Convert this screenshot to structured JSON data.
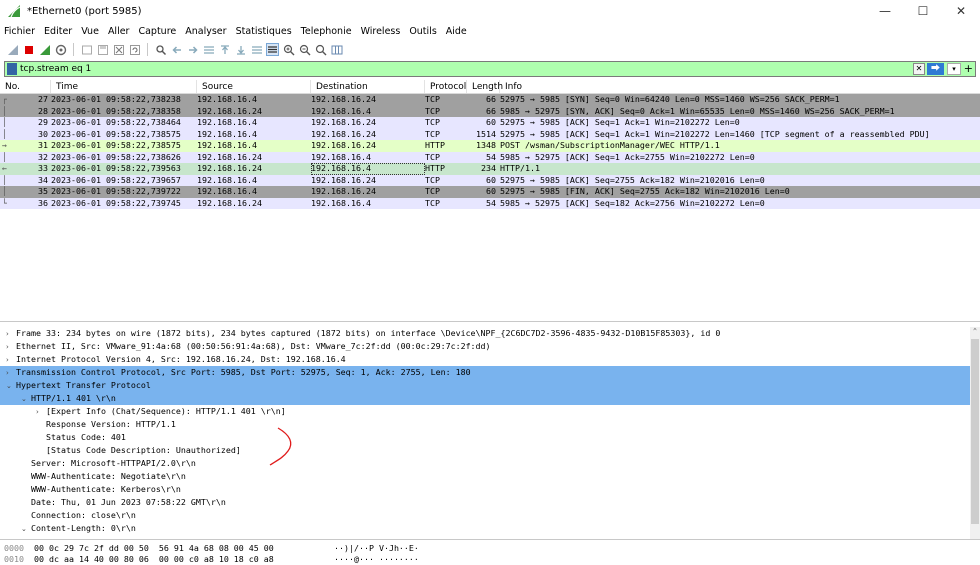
{
  "window": {
    "title": "*Ethernet0 (port 5985)",
    "minimize": "—",
    "maximize": "☐",
    "close": "✕"
  },
  "menu": [
    "Fichier",
    "Editer",
    "Vue",
    "Aller",
    "Capture",
    "Analyser",
    "Statistiques",
    "Telephonie",
    "Wireless",
    "Outils",
    "Aide"
  ],
  "filter": {
    "value": "tcp.stream eq 1"
  },
  "packet_list": {
    "headers": {
      "no": "No.",
      "time": "Time",
      "source": "Source",
      "destination": "Destination",
      "protocol": "Protocol",
      "length": "Length",
      "info": "Info"
    },
    "rows": [
      {
        "no": "27",
        "time": "2023-06-01 09:58:22,738238",
        "src": "192.168.16.4",
        "dst": "192.168.16.24",
        "proto": "TCP",
        "len": "66",
        "info": "52975 → 5985 [SYN] Seq=0 Win=64240 Len=0 MSS=1460 WS=256 SACK_PERM=1",
        "ind": "┌",
        "color": "syn"
      },
      {
        "no": "28",
        "time": "2023-06-01 09:58:22,738358",
        "src": "192.168.16.24",
        "dst": "192.168.16.4",
        "proto": "TCP",
        "len": "66",
        "info": "5985 → 52975 [SYN, ACK] Seq=0 Ack=1 Win=65535 Len=0 MSS=1460 WS=256 SACK_PERM=1",
        "ind": "│",
        "color": "syn"
      },
      {
        "no": "29",
        "time": "2023-06-01 09:58:22,738464",
        "src": "192.168.16.4",
        "dst": "192.168.16.24",
        "proto": "TCP",
        "len": "60",
        "info": "52975 → 5985 [ACK] Seq=1 Ack=1 Win=2102272 Len=0",
        "ind": "│",
        "color": "tcp"
      },
      {
        "no": "30",
        "time": "2023-06-01 09:58:22,738575",
        "src": "192.168.16.4",
        "dst": "192.168.16.24",
        "proto": "TCP",
        "len": "1514",
        "info": "52975 → 5985 [ACK] Seq=1 Ack=1 Win=2102272 Len=1460 [TCP segment of a reassembled PDU]",
        "ind": "│",
        "color": "tcp"
      },
      {
        "no": "31",
        "time": "2023-06-01 09:58:22,738575",
        "src": "192.168.16.4",
        "dst": "192.168.16.24",
        "proto": "HTTP",
        "len": "1348",
        "info": "POST /wsman/SubscriptionManager/WEC HTTP/1.1",
        "ind": "→",
        "color": "http"
      },
      {
        "no": "32",
        "time": "2023-06-01 09:58:22,738626",
        "src": "192.168.16.24",
        "dst": "192.168.16.4",
        "proto": "TCP",
        "len": "54",
        "info": "5985 → 52975 [ACK] Seq=1 Ack=2755 Win=2102272 Len=0",
        "ind": "│",
        "color": "tcp"
      },
      {
        "no": "33",
        "time": "2023-06-01 09:58:22,739563",
        "src": "192.168.16.24",
        "dst": "192.168.16.4",
        "proto": "HTTP",
        "len": "234",
        "info": "HTTP/1.1 401",
        "ind": "←",
        "color": "sel"
      },
      {
        "no": "34",
        "time": "2023-06-01 09:58:22,739657",
        "src": "192.168.16.4",
        "dst": "192.168.16.24",
        "proto": "TCP",
        "len": "60",
        "info": "52975 → 5985 [ACK] Seq=2755 Ack=182 Win=2102016 Len=0",
        "ind": "│",
        "color": "tcp"
      },
      {
        "no": "35",
        "time": "2023-06-01 09:58:22,739722",
        "src": "192.168.16.4",
        "dst": "192.168.16.24",
        "proto": "TCP",
        "len": "60",
        "info": "52975 → 5985 [FIN, ACK] Seq=2755 Ack=182 Win=2102016 Len=0",
        "ind": "│",
        "color": "syn"
      },
      {
        "no": "36",
        "time": "2023-06-01 09:58:22,739745",
        "src": "192.168.16.24",
        "dst": "192.168.16.4",
        "proto": "TCP",
        "len": "54",
        "info": "5985 → 52975 [ACK] Seq=182 Ack=2756 Win=2102272 Len=0",
        "ind": "└",
        "color": "tcp"
      }
    ]
  },
  "details": [
    {
      "text": "Frame 33: 234 bytes on wire (1872 bits), 234 bytes captured (1872 bits) on interface \\Device\\NPF_{2C6DC7D2-3596-4835-9432-D10B15F85303}, id 0",
      "indent": 0,
      "arrow": "›",
      "sel": false
    },
    {
      "text": "Ethernet II, Src: VMware_91:4a:68 (00:50:56:91:4a:68), Dst: VMware_7c:2f:dd (00:0c:29:7c:2f:dd)",
      "indent": 0,
      "arrow": "›",
      "sel": false
    },
    {
      "text": "Internet Protocol Version 4, Src: 192.168.16.24, Dst: 192.168.16.4",
      "indent": 0,
      "arrow": "›",
      "sel": false
    },
    {
      "text": "Transmission Control Protocol, Src Port: 5985, Dst Port: 52975, Seq: 1, Ack: 2755, Len: 180",
      "indent": 0,
      "arrow": "›",
      "sel": true
    },
    {
      "text": "Hypertext Transfer Protocol",
      "indent": 0,
      "arrow": "⌄",
      "sel": true
    },
    {
      "text": "HTTP/1.1 401 \\r\\n",
      "indent": 1,
      "arrow": "⌄",
      "sel": true
    },
    {
      "text": "[Expert Info (Chat/Sequence): HTTP/1.1 401 \\r\\n]",
      "indent": 2,
      "arrow": "›",
      "sel": false
    },
    {
      "text": "Response Version: HTTP/1.1",
      "indent": 2,
      "arrow": "",
      "sel": false
    },
    {
      "text": "Status Code: 401",
      "indent": 2,
      "arrow": "",
      "sel": false
    },
    {
      "text": "[Status Code Description: Unauthorized]",
      "indent": 2,
      "arrow": "",
      "sel": false
    },
    {
      "text": "Server: Microsoft-HTTPAPI/2.0\\r\\n",
      "indent": 1,
      "arrow": "",
      "sel": false
    },
    {
      "text": "WWW-Authenticate: Negotiate\\r\\n",
      "indent": 1,
      "arrow": "",
      "sel": false
    },
    {
      "text": "WWW-Authenticate: Kerberos\\r\\n",
      "indent": 1,
      "arrow": "",
      "sel": false
    },
    {
      "text": "Date: Thu, 01 Jun 2023 07:58:22 GMT\\r\\n",
      "indent": 1,
      "arrow": "",
      "sel": false
    },
    {
      "text": "Connection: close\\r\\n",
      "indent": 1,
      "arrow": "",
      "sel": false
    },
    {
      "text": "Content-Length: 0\\r\\n",
      "indent": 1,
      "arrow": "⌄",
      "sel": false
    }
  ],
  "bytes": [
    {
      "offset": "0000",
      "hex": "00 0c 29 7c 2f dd 00 50  56 91 4a 68 08 00 45 00",
      "ascii": "··)|/··P V·Jh··E·"
    },
    {
      "offset": "0010",
      "hex": "00 dc aa 14 40 00 80 06  00 00 c0 a8 10 18 c0 a8",
      "ascii": "····@··· ········"
    }
  ],
  "colors": {
    "syn": "#a0a0a0",
    "tcp": "#e7e6ff",
    "http": "#e4ffc7",
    "selected": "#c7e6cc",
    "tree_selected": "#79b3ee",
    "filter_ok": "#afffaf"
  }
}
